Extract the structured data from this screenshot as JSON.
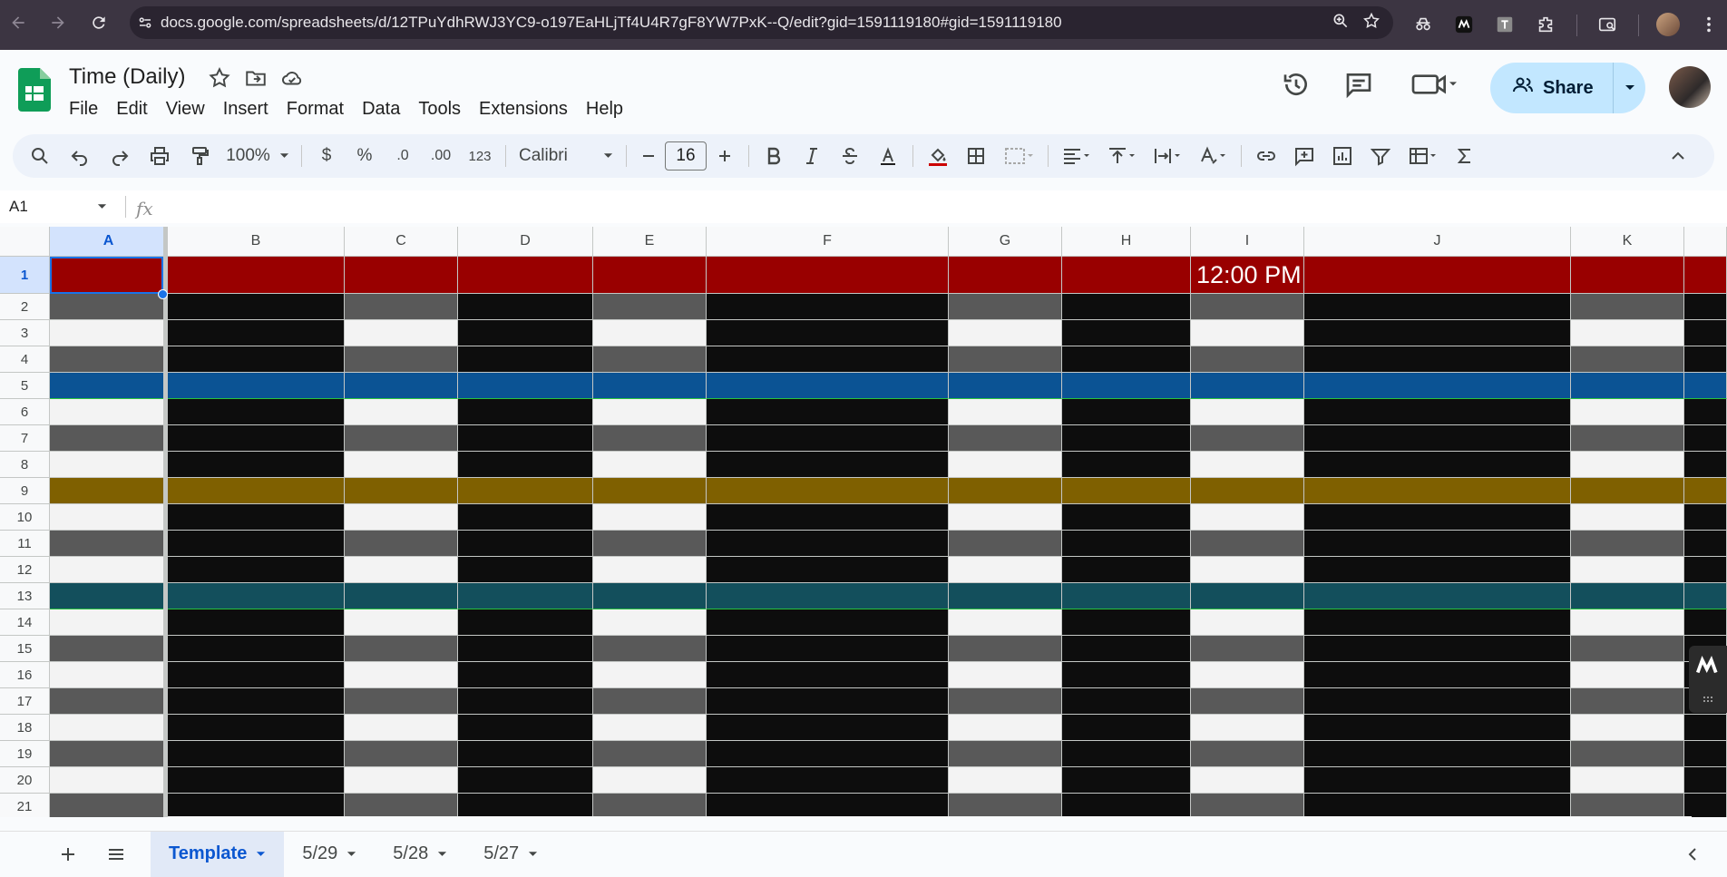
{
  "browser": {
    "url": "docs.google.com/spreadsheets/d/12TPuYdhRWJ3YC9-o197EaHLjTf4U4R7gF8YW7PxK--Q/edit?gid=1591119180#gid=1591119180"
  },
  "doc": {
    "title": "Time (Daily)",
    "menus": [
      "File",
      "Edit",
      "View",
      "Insert",
      "Format",
      "Data",
      "Tools",
      "Extensions",
      "Help"
    ],
    "share_label": "Share"
  },
  "toolbar": {
    "zoom": "100%",
    "currency": "$",
    "percent": "%",
    "dec_decrease": ".0",
    "dec_increase": ".00",
    "number_format": "123",
    "font": "Calibri",
    "font_size": "16"
  },
  "formula_bar": {
    "cell_ref": "A1",
    "fx": "fx",
    "value": ""
  },
  "sheet": {
    "columns": [
      "A",
      "B",
      "C",
      "D",
      "E",
      "F",
      "G",
      "H",
      "I",
      "J",
      "K"
    ],
    "rows": [
      "1",
      "2",
      "3",
      "4",
      "5",
      "6",
      "7",
      "8",
      "9",
      "10",
      "11",
      "12",
      "13",
      "14",
      "15",
      "16",
      "17",
      "18",
      "19",
      "20",
      "21"
    ],
    "selected_cell": "A1",
    "cell_I1": "12:00 PM",
    "colors": {
      "header_red": "#990000",
      "dark_gray": "#595959",
      "light_gray": "#f3f3f3",
      "black": "#0d0d0d",
      "blue": "#0b5394",
      "gold": "#7f6000",
      "teal": "#134f5c"
    }
  },
  "tabs": {
    "items": [
      "Template",
      "5/29",
      "5/28",
      "5/27"
    ],
    "active": "Template"
  }
}
